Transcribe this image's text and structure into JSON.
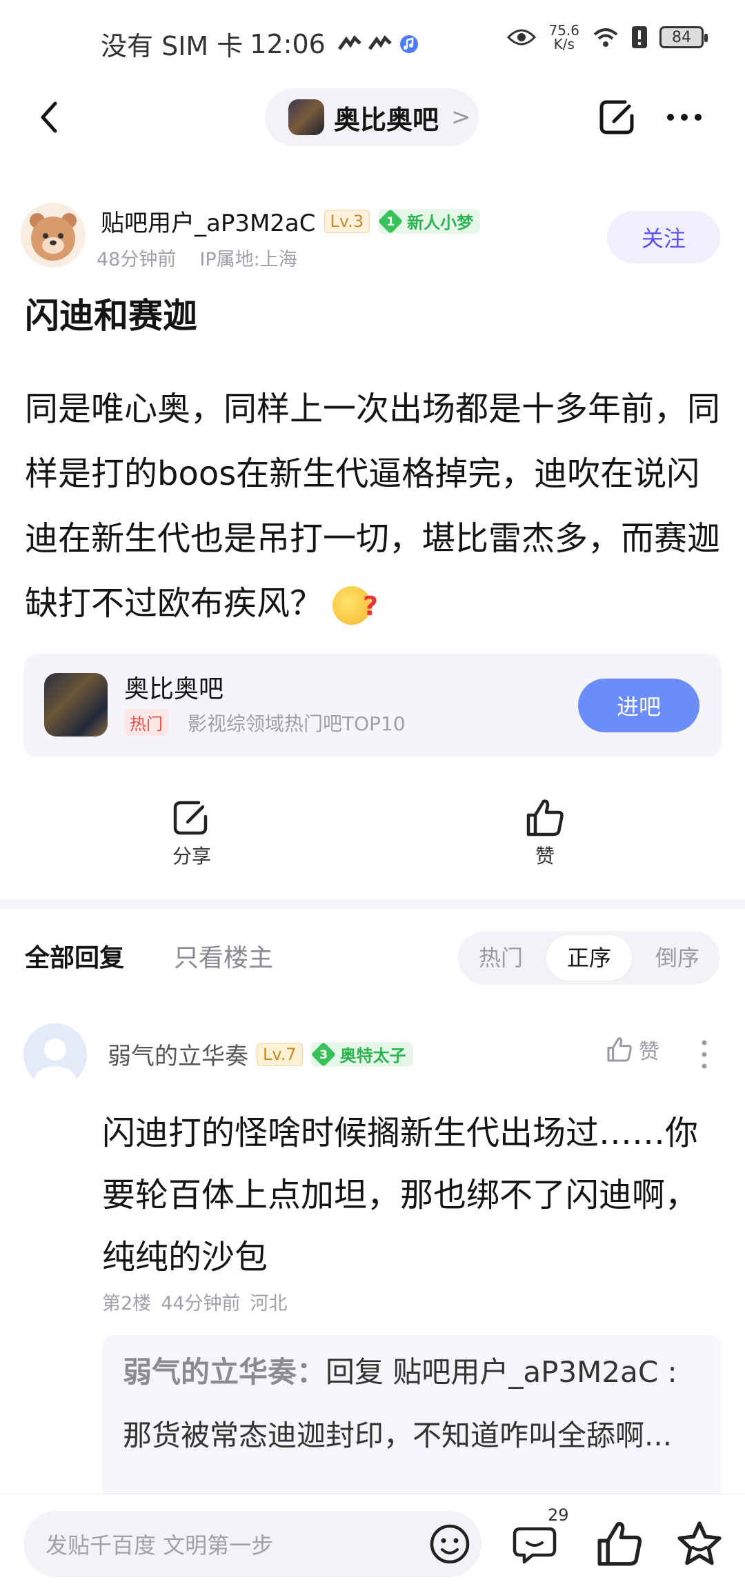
{
  "status_bar": {
    "carrier": "没有 SIM 卡",
    "time": "12:06",
    "speed_value": "75.6",
    "speed_unit": "K/s",
    "battery": "84"
  },
  "nav": {
    "forum_name": "奥比奥吧",
    "chevron": ">"
  },
  "post": {
    "author": "贴吧用户_aP3M2aC",
    "level": "Lv.3",
    "title_badge_num": "1",
    "title_badge": "新人小梦",
    "time": "48分钟前",
    "ip": "IP属地:上海",
    "follow": "关注",
    "title": "闪迪和赛迦",
    "body": "同是唯心奥，同样上一次出场都是十多年前，同样是打的boos在新生代逼格掉完，迪吹在说闪迪在新生代也是吊打一切，堪比雷杰多，而赛迦缺打不过欧布疾风？"
  },
  "forum_card": {
    "name": "奥比奥吧",
    "hot": "热门",
    "desc": "影视综领域热门吧TOP10",
    "join": "进吧"
  },
  "actions": {
    "share": "分享",
    "like": "赞"
  },
  "reply_tabs": {
    "all": "全部回复",
    "owner_only": "只看楼主",
    "sort": [
      "热门",
      "正序",
      "倒序"
    ],
    "active_sort": "正序"
  },
  "comment": {
    "author": "弱气的立华奏",
    "level": "Lv.7",
    "title_badge_num": "3",
    "title_badge": "奥特太子",
    "like": "赞",
    "body": "闪迪打的怪啥时候搁新生代出场过……你要轮百体上点加坦，那也绑不了闪迪啊，纯纯的沙包",
    "floor": "第2楼",
    "time": "44分钟前",
    "location": "河北",
    "quote_name": "弱气的立华奏",
    "quote_sep": "：",
    "quote_text": "回复 贴吧用户_aP3M2aC :那货被常态迪迦封印，不知道咋叫全舔啊..."
  },
  "bottom_bar": {
    "placeholder": "发贴千百度 文明第一步",
    "comment_count": "29"
  },
  "colors": {
    "accent": "#6a8dfa",
    "follow_text": "#5a55e8",
    "badge_green": "#39c25a",
    "hot_red": "#ef4b4b"
  }
}
